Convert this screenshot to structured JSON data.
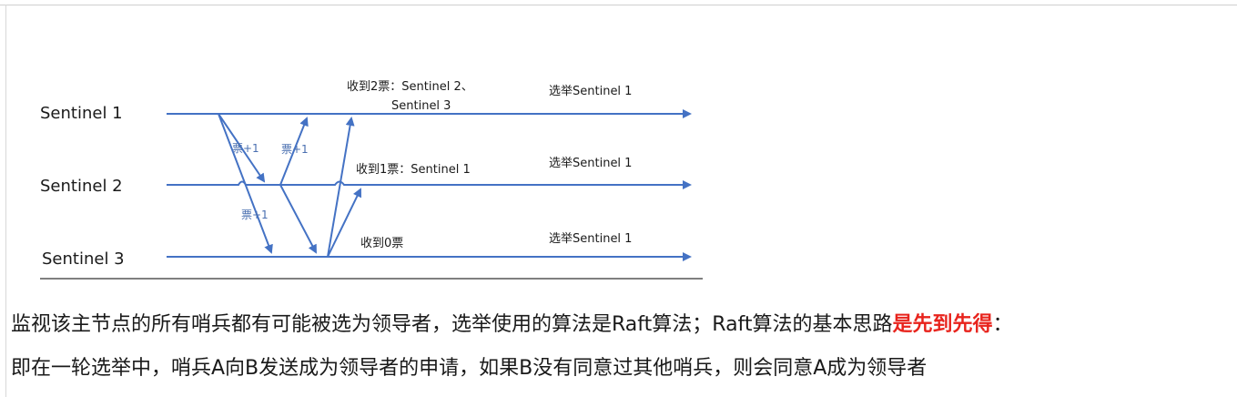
{
  "diagram": {
    "sentinels": [
      "Sentinel 1",
      "Sentinel 2",
      "Sentinel 3"
    ],
    "vote_label": "票+1",
    "received": {
      "s1_line1": "收到2票：Sentinel 2、",
      "s1_line2": "Sentinel 3",
      "s2": "收到1票：Sentinel 1",
      "s3": "收到0票"
    },
    "elect": {
      "s1": "选举Sentinel 1",
      "s2": "选举Sentinel 1",
      "s3": "选举Sentinel 1"
    },
    "colors": {
      "arrow": "#4472c4",
      "highlight": "#e8231c"
    }
  },
  "text": {
    "line1_part1": "监视该主节点的所有哨兵都有可能被选为领导者，选举使用的算法是Raft算法；Raft算法的基本思路",
    "line1_highlight": "是先到先得",
    "line1_end": "：",
    "line2": "即在一轮选举中，哨兵A向B发送成为领导者的申请，如果B没有同意过其他哨兵，则会同意A成为领导者"
  }
}
